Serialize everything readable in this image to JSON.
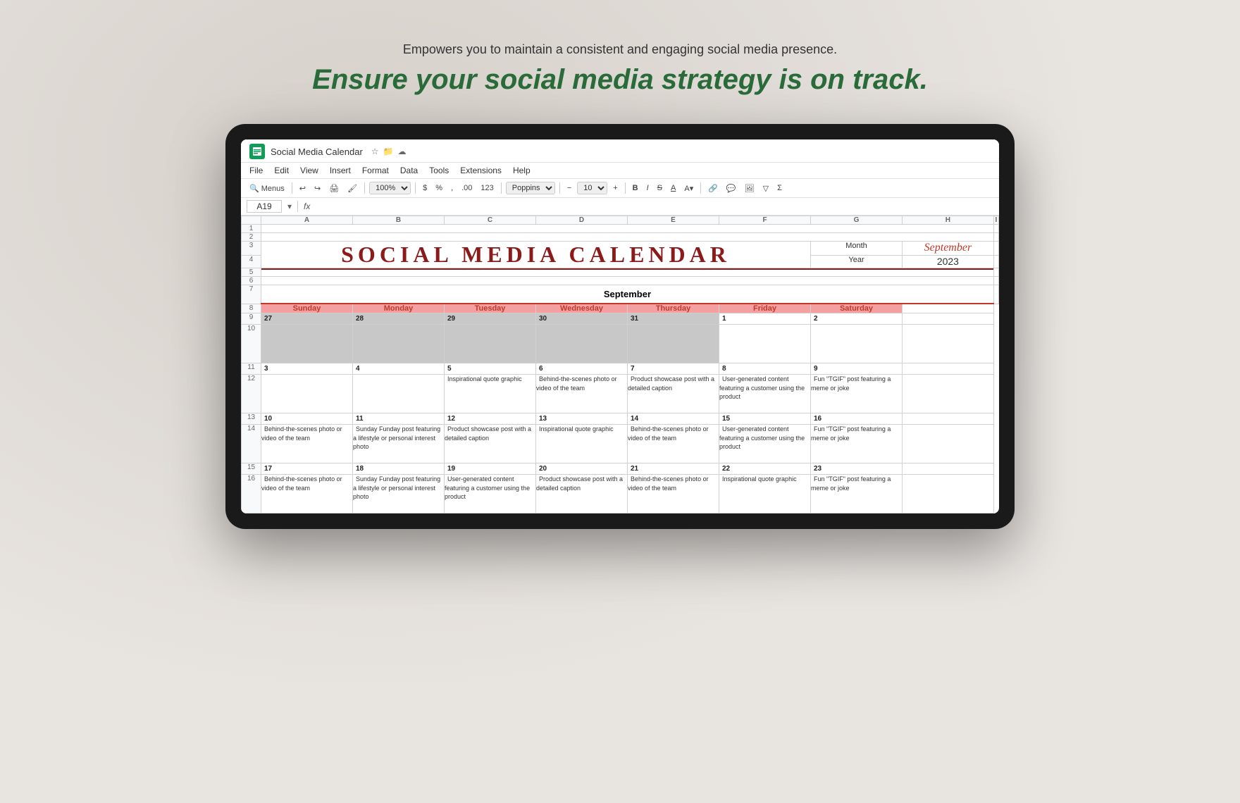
{
  "page": {
    "subtitle": "Empowers you to maintain a consistent and engaging social media presence.",
    "title": "Ensure your social media strategy is on track."
  },
  "sheets": {
    "title": "Social Media Calendar",
    "menu": [
      "File",
      "Edit",
      "View",
      "Insert",
      "Format",
      "Data",
      "Tools",
      "Extensions",
      "Help"
    ],
    "cell_ref": "A19",
    "toolbar": {
      "zoom": "100%",
      "font": "Poppins",
      "font_size": "10"
    }
  },
  "calendar": {
    "smc_title": "SOCIAL MEDIA CALENDAR",
    "month_label": "Month",
    "month_value": "September",
    "year_label": "Year",
    "year_value": "2023",
    "section_month": "September",
    "days": [
      "Sunday",
      "Monday",
      "Tuesday",
      "Wednesday",
      "Thursday",
      "Friday",
      "Saturday"
    ],
    "rows": [
      {
        "row_num": 9,
        "dates": [
          "27",
          "28",
          "29",
          "30",
          "31",
          "1",
          "2"
        ],
        "cells": [
          "grey",
          "grey",
          "grey",
          "grey",
          "grey",
          "",
          ""
        ],
        "content": [
          "",
          "",
          "",
          "",
          "",
          "",
          ""
        ]
      },
      {
        "row_num": 11,
        "dates": [
          "3",
          "4",
          "5",
          "6",
          "7",
          "8",
          "9"
        ],
        "cells": [
          "",
          "",
          "",
          "",
          "",
          "",
          ""
        ],
        "content": [
          "",
          "",
          "Inspirational quote graphic",
          "Behind-the-scenes photo or video of the team",
          "Product showcase post with a detailed caption",
          "User-generated content featuring a customer using the product",
          "Fun \"TGIF\" post featuring a meme or joke"
        ]
      },
      {
        "row_num": 13,
        "dates": [
          "10",
          "11",
          "12",
          "13",
          "14",
          "15",
          "16"
        ],
        "cells": [
          "",
          "",
          "",
          "",
          "",
          "",
          ""
        ],
        "content": [
          "Behind-the-scenes photo or video of the team",
          "Sunday Funday post featuring a lifestyle or personal interest photo",
          "Product showcase post with a detailed caption",
          "Inspirational quote graphic",
          "Behind-the-scenes photo or video of the team",
          "User-generated content featuring a customer using the product",
          "Fun \"TGIF\" post featuring a meme or joke"
        ]
      },
      {
        "row_num": 15,
        "dates": [
          "17",
          "18",
          "19",
          "20",
          "21",
          "22",
          "23"
        ],
        "cells": [
          "",
          "",
          "",
          "",
          "",
          "",
          ""
        ],
        "content": [
          "Behind-the-scenes photo or video of the team",
          "Sunday Funday post featuring a lifestyle or personal interest photo",
          "User-generated content featuring a customer using the product",
          "Product showcase post with a detailed caption",
          "Behind-the-scenes photo or video of the team",
          "Inspirational quote graphic",
          "Fun \"TGIF\" post featuring a meme or joke"
        ]
      }
    ],
    "row_numbers": [
      "1",
      "2",
      "3",
      "4",
      "5",
      "6",
      "7",
      "8",
      "9",
      "10",
      "11",
      "12",
      "13",
      "14",
      "15",
      "16"
    ],
    "col_letters": [
      "A",
      "B",
      "C",
      "D",
      "E",
      "F",
      "G",
      "H",
      "I"
    ]
  }
}
